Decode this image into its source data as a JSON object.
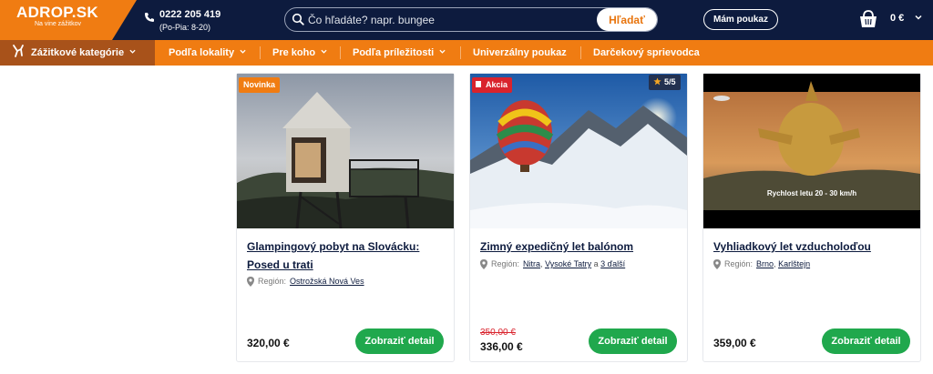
{
  "header": {
    "logo": "ADROP.SK",
    "tagline": "Na vine zážitkov",
    "phone": "0222 205 419",
    "hours": "(Po-Pia: 8-20)",
    "search_placeholder": "Čo hľadáte? napr. bungee",
    "search_button": "Hľadať",
    "voucher_button": "Mám poukaz",
    "cart_total": "0 €"
  },
  "nav": {
    "items": [
      "Zážitkové kategórie",
      "Podľa lokality",
      "Pre koho",
      "Podľa príležitosti",
      "Univerzálny poukaz",
      "Darčekový sprievodca"
    ]
  },
  "cards": [
    {
      "badge": "Novinka",
      "title": "Glampingový pobyt na Slovácku: Posed u trati",
      "region_label": "Región:",
      "regions": [
        "Ostrožská Nová Ves"
      ],
      "price": "320,00 €",
      "button": "Zobraziť detail"
    },
    {
      "badge": "Akcia",
      "rating": "5/5",
      "title": "Zimný expedičný let balónom",
      "region_label": "Región:",
      "regions": [
        "Nitra",
        "Vysoké Tatry"
      ],
      "regions_more_prefix": "a",
      "regions_more": "3 ďalší",
      "old_price": "350,00 €",
      "price": "336,00 €",
      "button": "Zobraziť detail"
    },
    {
      "title": "Vyhliadkový let vzducholoďou",
      "image_caption": "Rychlost letu 20 - 30 km/h",
      "region_label": "Región:",
      "regions": [
        "Brno",
        "Karlštejn"
      ],
      "price": "359,00 €",
      "button": "Zobraziť detail"
    }
  ],
  "colors": {
    "navy": "#0d1b3e",
    "orange": "#f07c12",
    "green": "#20a84d",
    "sale_red": "#d9232d"
  }
}
